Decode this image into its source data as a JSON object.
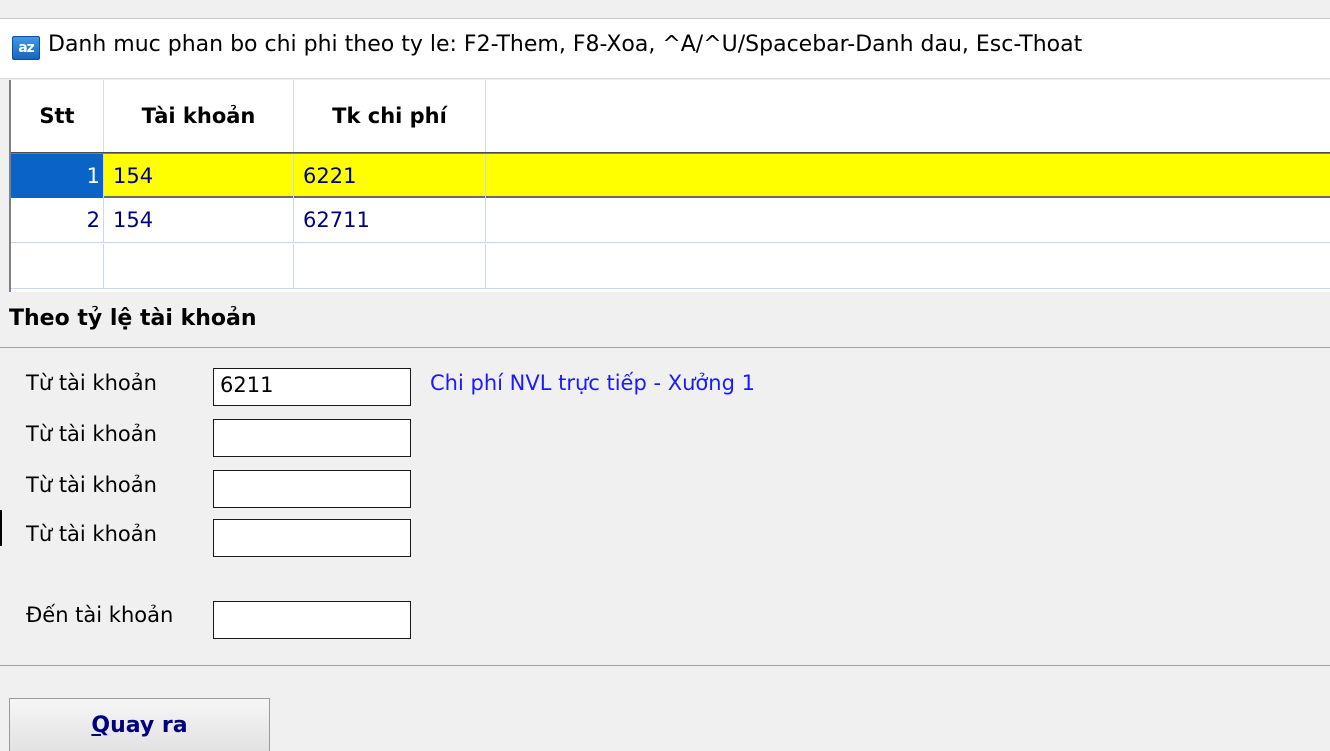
{
  "window": {
    "icon_text": "az",
    "title": "Danh muc phan bo chi phi theo ty le: F2-Them, F8-Xoa, ^A/^U/Spacebar-Danh dau, Esc-Thoat"
  },
  "grid": {
    "columns": [
      "Stt",
      "Tài khoản",
      "Tk chi phí"
    ],
    "rows": [
      {
        "stt": "1",
        "tai_khoan": "154",
        "tk_chi_phi": "6221"
      },
      {
        "stt": "2",
        "tai_khoan": "154",
        "tk_chi_phi": "62711"
      }
    ]
  },
  "section": {
    "title": "Theo tỷ lệ tài khoản",
    "from_label": "Từ tài khoản",
    "from_values": [
      "6211",
      "",
      "",
      ""
    ],
    "from_desc": "Chi phí NVL trực tiếp - Xưởng 1",
    "to_label": "Đến tài khoản",
    "to_value": ""
  },
  "buttons": {
    "exit_hotkey": "Q",
    "exit_rest": "uay ra"
  },
  "colors": {
    "selected_row": "#ffff00",
    "active_cell": "#0a64c8",
    "cell_text": "#000080",
    "description_text": "#1a1aff"
  }
}
